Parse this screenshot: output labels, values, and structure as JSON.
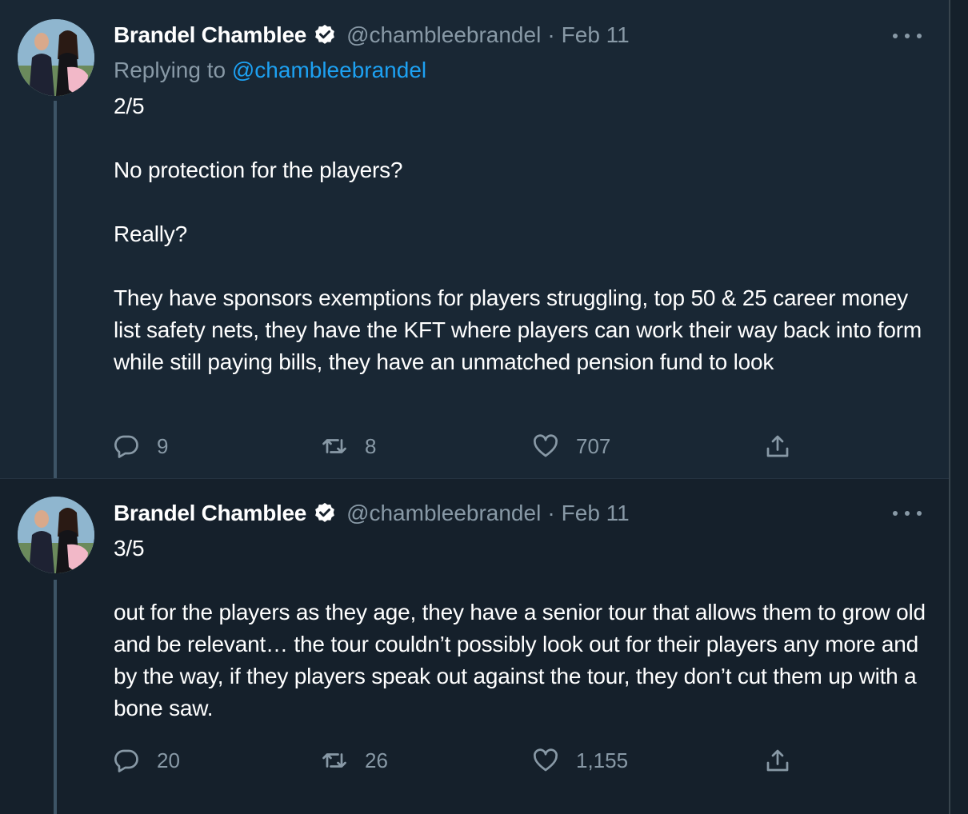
{
  "tweets": [
    {
      "author_name": "Brandel Chamblee",
      "handle": "@chambleebrandel",
      "separator": "·",
      "date": "Feb 11",
      "replying_prefix": "Replying to",
      "replying_handle": "@chambleebrandel",
      "text": "2/5\n\nNo protection for the players?\n\nReally?\n\nThey have sponsors exemptions for players struggling, top 50 & 25 career money list safety nets, they have the KFT where players can work their way back into form while still paying bills, they have an unmatched pension fund to look",
      "reply_count": "9",
      "retweet_count": "8",
      "like_count": "707"
    },
    {
      "author_name": "Brandel Chamblee",
      "handle": "@chambleebrandel",
      "separator": "·",
      "date": "Feb 11",
      "text": "3/5\n\nout for the players as they age, they have a senior tour that allows them to grow old and be relevant… the tour couldn’t possibly look out for their players any more and by the way, if they players speak out against the tour, they don’t cut them up with a bone saw.",
      "reply_count": "20",
      "retweet_count": "26",
      "like_count": "1,155"
    }
  ],
  "icons": {
    "verified": "verified-badge-icon",
    "more": "more-options-icon",
    "reply": "reply-icon",
    "retweet": "retweet-icon",
    "like": "like-heart-icon",
    "share": "share-icon"
  },
  "colors": {
    "background": "#15202b",
    "highlight_background": "#192734",
    "link": "#1da1f2",
    "secondary_text": "#8899a6",
    "thread_line": "#3d5466"
  }
}
